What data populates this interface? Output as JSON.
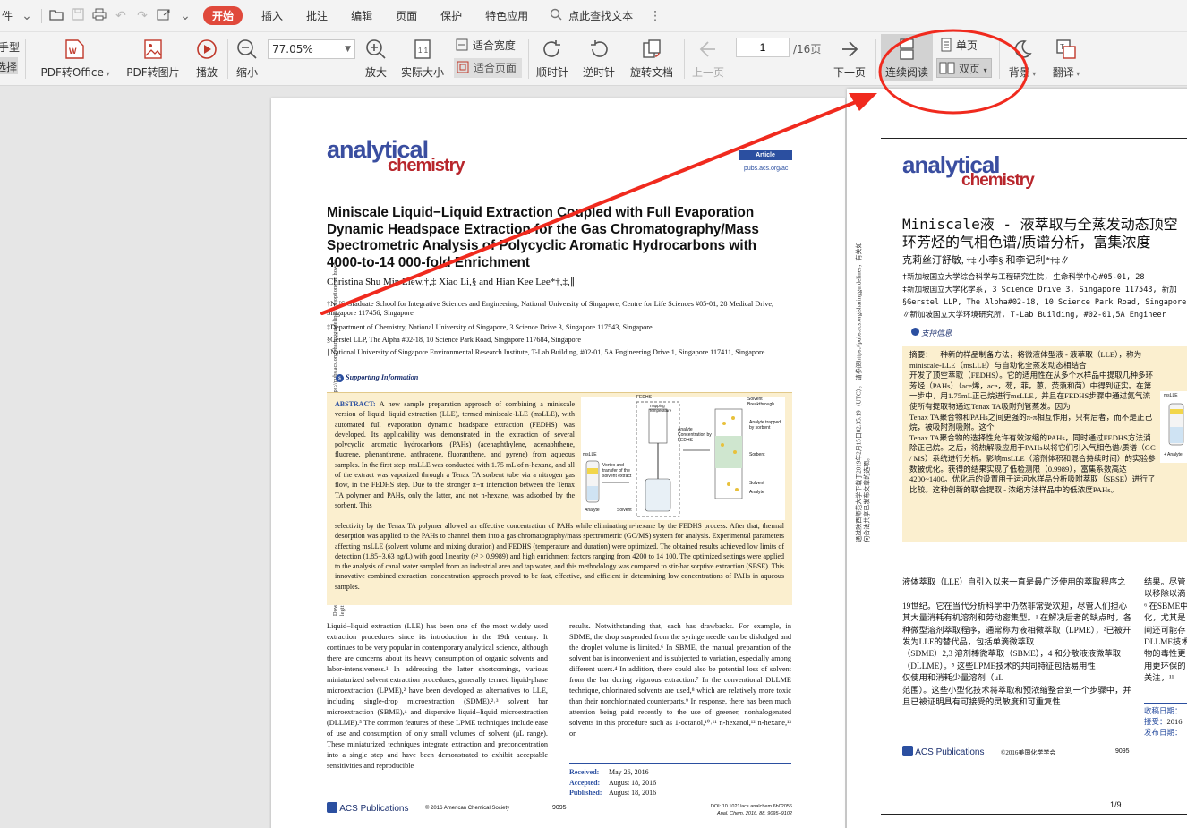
{
  "menu": {
    "items": [
      "件",
      "开始",
      "插入",
      "批注",
      "编辑",
      "页面",
      "保护",
      "特色应用"
    ],
    "search_label": "点此查找文本",
    "active": "开始"
  },
  "toolbar": {
    "hand_label": "手型",
    "select_label": "选择",
    "pdf_to_office": "PDF转Office",
    "pdf_to_image": "PDF转图片",
    "play": "播放",
    "zoom_out": "缩小",
    "zoom_value": "77.05%",
    "zoom_in": "放大",
    "actual_size": "实际大小",
    "fit_width": "适合宽度",
    "fit_page": "适合页面",
    "rotate_cw": "顺时针",
    "rotate_ccw": "逆时针",
    "rotate_doc": "旋转文档",
    "prev_page": "上一页",
    "page_current": "1",
    "page_total": "/16页",
    "next_page": "下一页",
    "continuous": "连续阅读",
    "single": "单页",
    "double": "双页",
    "background": "背景",
    "translate": "翻译"
  },
  "page1": {
    "logo_top": "analytical",
    "logo_bottom": "chemistry",
    "badge": "Article",
    "url": "pubs.acs.org/ac",
    "title": "Miniscale Liquid−Liquid Extraction Coupled with Full Evaporation Dynamic Headspace Extraction for the Gas Chromatography/Mass Spectrometric Analysis of Polycyclic Aromatic Hydrocarbons with 4000-to-14 000-fold Enrichment",
    "authors": "Christina Shu Min Liew,†,‡ Xiao Li,§ and Hian Kee Lee*†,‡,∥",
    "affil1": "†NUS Graduate School for Integrative Sciences and Engineering, National University of Singapore, Centre for Life Sciences #05-01, 28 Medical Drive, Singapore 117456, Singapore",
    "affil2": "‡Department of Chemistry, National University of Singapore, 3 Science Drive 3, Singapore 117543, Singapore",
    "affil3": "§Gerstel LLP, The Alpha #02-18, 10 Science Park Road, Singapore 117684, Singapore",
    "affil4": "∥National University of Singapore Environmental Research Institute, T-Lab Building, #02-01, 5A Engineering Drive 1, Singapore 117411, Singapore",
    "support": "Supporting Information",
    "abstract_head": "ABSTRACT:",
    "abstract_part1": "A new sample preparation approach of combining a miniscale version of liquid−liquid extraction (LLE), termed miniscale-LLE (msLLE), with automated full evaporation dynamic headspace extraction (FEDHS) was developed. Its applicability was demonstrated in the extraction of several polycyclic aromatic hydrocarbons (PAHs) (acenaphthylene, acenaphthene, fluorene, phenanthrene, anthracene, fluoranthene, and pyrene) from aqueous samples. In the first step, msLLE was conducted with 1.75 mL of n-hexane, and all of the extract was vaporized through a Tenax TA sorbent tube via a nitrogen gas flow, in the FEDHS step. Due to the stronger π−π interaction between the Tenax TA polymer and PAHs, only the latter, and not n-hexane, was adsorbed by the sorbent. This",
    "abstract_part2": "selectivity by the Tenax TA polymer allowed an effective concentration of PAHs while eliminating n-hexane by the FEDHS process. After that, thermal desorption was applied to the PAHs to channel them into a gas chromatography/mass spectrometric (GC/MS) system for analysis. Experimental parameters affecting msLLE (solvent volume and mixing duration) and FEDHS (temperature and duration) were optimized. The obtained results achieved low limits of detection (1.85−3.63 ng/L) with good linearity (r² > 0.9989) and high enrichment factors ranging from 4200 to 14 100. The optimized settings were applied to the analysis of canal water sampled from an industrial area and tap water, and this methodology was compared to stir-bar sorptive extraction (SBSE). This innovative combined extraction−concentration approach proved to be fast, effective, and efficient in determining low concentrations of PAHs in aqueous samples.",
    "fig_labels": [
      "FEDHS",
      "Trapping Temperature",
      "Solvent Breakthrough",
      "Analyte trapped by sorbent",
      "Sorbent",
      "Solvent",
      "Analyte",
      "Analyte Concentration by FEDHS",
      "msLLE",
      "Vortex and transfer of the solvent extract",
      "Analyte",
      "Solvent"
    ],
    "body_left": "Liquid−liquid extraction (LLE) has been one of the most widely used extraction procedures since its introduction in the 19th century. It continues to be very popular in contemporary analytical science, although there are concerns about its heavy consumption of organic solvents and labor-intensiveness.¹ In addressing the latter shortcomings, various miniaturized solvent extraction procedures, generally termed liquid-phase microextraction (LPME),² have been developed as alternatives to LLE, including single-drop microextraction (SDME),²˒³ solvent bar microextraction (SBME),⁴ and dispersive liquid−liquid microextraction (DLLME).⁵ The common features of these LPME techniques include ease of use and consumption of only small volumes of solvent (μL range). These miniaturized techniques integrate extraction and preconcentration into a single step and have been demonstrated to exhibit acceptable sensitivities and reproducible",
    "body_right": "results. Notwithstanding that, each has drawbacks. For example, in SDME, the drop suspended from the syringe needle can be dislodged and the droplet volume is limited.⁶ In SBME, the manual preparation of the solvent bar is inconvenient and is subjected to variation, especially among different users.⁴ In addition, there could also be potential loss of solvent from the bar during vigorous extraction.⁷ In the conventional DLLME technique, chlorinated solvents are used,⁸ which are relatively more toxic than their nonchlorinated counterparts.⁹ In response, there has been much attention being paid recently to the use of greener, nonhalogenated solvents in this procedure such as 1-octanol,¹⁰˒¹¹ n-hexanol,¹² n-hexane,¹³ or",
    "received_label": "Received:",
    "received": "May 26, 2016",
    "accepted_label": "Accepted:",
    "accepted": "August 18, 2016",
    "published_label": "Published:",
    "published": "August 18, 2016",
    "footer_copy": "© 2016 American Chemical Society",
    "footer_page": "9095",
    "footer_doi": "DOI: 10.1021/acs.analchem.6b02056",
    "footer_journal": "Anal. Chem. 2016, 88, 9095−9102",
    "acs": "ACS Publications",
    "side_note": "Downloaded via SHAANXI NORMAL UNIV on February 15, 2019 at 02:35:19 (UTC). See https://pubs.acs.org/sharingguidelines for options on how to legitimately share published articles."
  },
  "page2": {
    "logo_top": "analytical",
    "logo_bottom": "chemistry",
    "title_l1": "Miniscale液 - 液萃取与全蒸发动态顶空",
    "title_l2": "环芳烃的气相色谱/质谱分析，富集浓度",
    "authors": "克莉丝汀舒敏, †‡ 小李§ 和李记利*†‡∥",
    "affil1": "†新加坡国立大学综合科学与工程研究生院, 生命科学中心#05-01, 28",
    "affil2": "‡新加坡国立大学化学系, 3 Science Drive 3, Singapore 117543, 新加",
    "affil3": "§Gerstel LLP, The Alpha#02-18, 10 Science Park Road, Singapore",
    "affil4": "∥新加坡国立大学环境研究所, T-Lab Building, #02-01,5A Engineer",
    "support": "支持信息",
    "abstract": "摘要：一种新的样品制备方法，将微液体型液 - 液萃取（LLE），称为miniscale-LLE（msLLE）与自动化全蒸发动态相结合\n开发了顶空萃取（FEDHS）。它的适用性在从多个水样品中提取几种多环芳烃（PAHs）（ace烯，ace，芴，菲，蒽，荧蒗和苘）中得到证实。在第一步中，用1.75mL正己烷进行msLLE，并且在FEDHS步骤中通过氮气流使所有提取物通过Tenax TA吸附剂管蒸发。因为\nTenax TA聚合物和PAHs之间更强的π-π相互作用，只有后者，而不是正己烷，被吸附剂吸附。这个\nTenax TA聚合物的选择性允许有效浓缩的PAHs，同时通过FEDHS方法消除正己烷。之后，将热解吸应用于PAHs以将它们引入气相色谱/质谱（GC / MS）系统进行分析。影响msLLE（溶剂体积和混合持续时间）的实验参数被优化。获得的结果实现了低检测限（0.9989），富集系数高达4200~1400。优化后的设置用于运河水样品分析吸附萃取（SBSE）进行了比较。这种创新的联合提取 - 浓缩方法样品中的低浓度PAHs。",
    "fig_labels": [
      "msLLE",
      "+ Analyte"
    ],
    "body_left": "液体萃取（LLE）自引入以来一直是最广泛使用的萃取程序之一\n19世纪。它在当代分析科学中仍然非常受欢迎，尽管人们担心其大量消耗有机溶剂和劳动密集型。¹ 在解决后者的缺点时，各种微型溶剂萃取程序，通常称为液相微萃取（LPME），²已被开发为LLE的替代品，包括单滴微萃取\n（SDME）2,3 溶剂棒微萃取（SBME），4 和分散液液微萃取（DLLME）。⁵ 这些LPME技术的共同特征包括易用性\n仅使用和消耗少量溶剂（μL\n范围）。这些小型化技术将萃取和预浓缩整合到一个步骤中，并且已被证明具有可接受的灵敏度和可重复性",
    "body_right": "结果。尽管\n以移除以滴\n⁶ 在SBME中\n化，尤其是\n间还可能存\nDLLME技术\n物的毒性更\n用更环保的\n关注，¹¹",
    "received_label": "收稿日期：",
    "accepted_label": "接受：",
    "accepted": "2016",
    "published_label": "发布日期：",
    "acs": "ACS Publications",
    "footer_copy": "©2016美国化学学会",
    "footer_page": "9095",
    "page_of": "1/9",
    "side_note": "通过陕西师范大学下载于2019年2月15日02:35:19（UTC）。 请参阅https://pubs.acs.org/sharingguidelines，有关如何合法共享已发布文章的选项。"
  },
  "colors": {
    "accent_red": "#e0493b",
    "logo_blue": "#3a4ea0",
    "logo_red": "#b8262c",
    "abstract_bg": "#fbefcf",
    "annotation_red": "#f02a1e"
  }
}
